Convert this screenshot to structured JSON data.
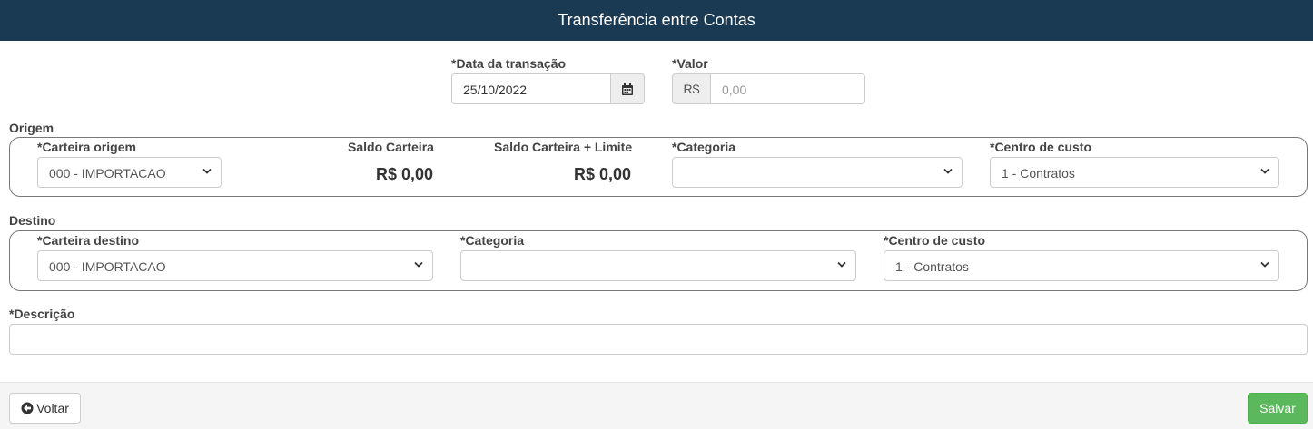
{
  "header": {
    "title": "Transferência entre Contas"
  },
  "transaction": {
    "date_label": "*Data da transação",
    "date_value": "25/10/2022",
    "value_label": "*Valor",
    "currency_addon": "R$",
    "value_placeholder": "0,00"
  },
  "origem": {
    "legend": "Origem",
    "carteira_label": "*Carteira origem",
    "carteira_value": "000 - IMPORTACAO",
    "saldo_label": "Saldo Carteira",
    "saldo_value": "R$ 0,00",
    "saldo_limite_label": "Saldo Carteira + Limite",
    "saldo_limite_value": "R$ 0,00",
    "categoria_label": "*Categoria",
    "categoria_value": "",
    "centro_label": "*Centro de custo",
    "centro_value": "1 - Contratos"
  },
  "destino": {
    "legend": "Destino",
    "carteira_label": "*Carteira destino",
    "carteira_value": "000 - IMPORTACAO",
    "categoria_label": "*Categoria",
    "categoria_value": "",
    "centro_label": "*Centro de custo",
    "centro_value": "1 - Contratos"
  },
  "descricao": {
    "label": "*Descrição",
    "value": ""
  },
  "footer": {
    "voltar_label": "Voltar",
    "salvar_label": "Salvar"
  },
  "icons": {
    "calendar": "calendar-icon",
    "back": "circle-arrow-left-icon",
    "select": "chevron-down-icon"
  },
  "colors": {
    "header_bg": "#1a3a54",
    "save_button": "#5cb85c",
    "footer_bg": "#f5f5f5"
  }
}
